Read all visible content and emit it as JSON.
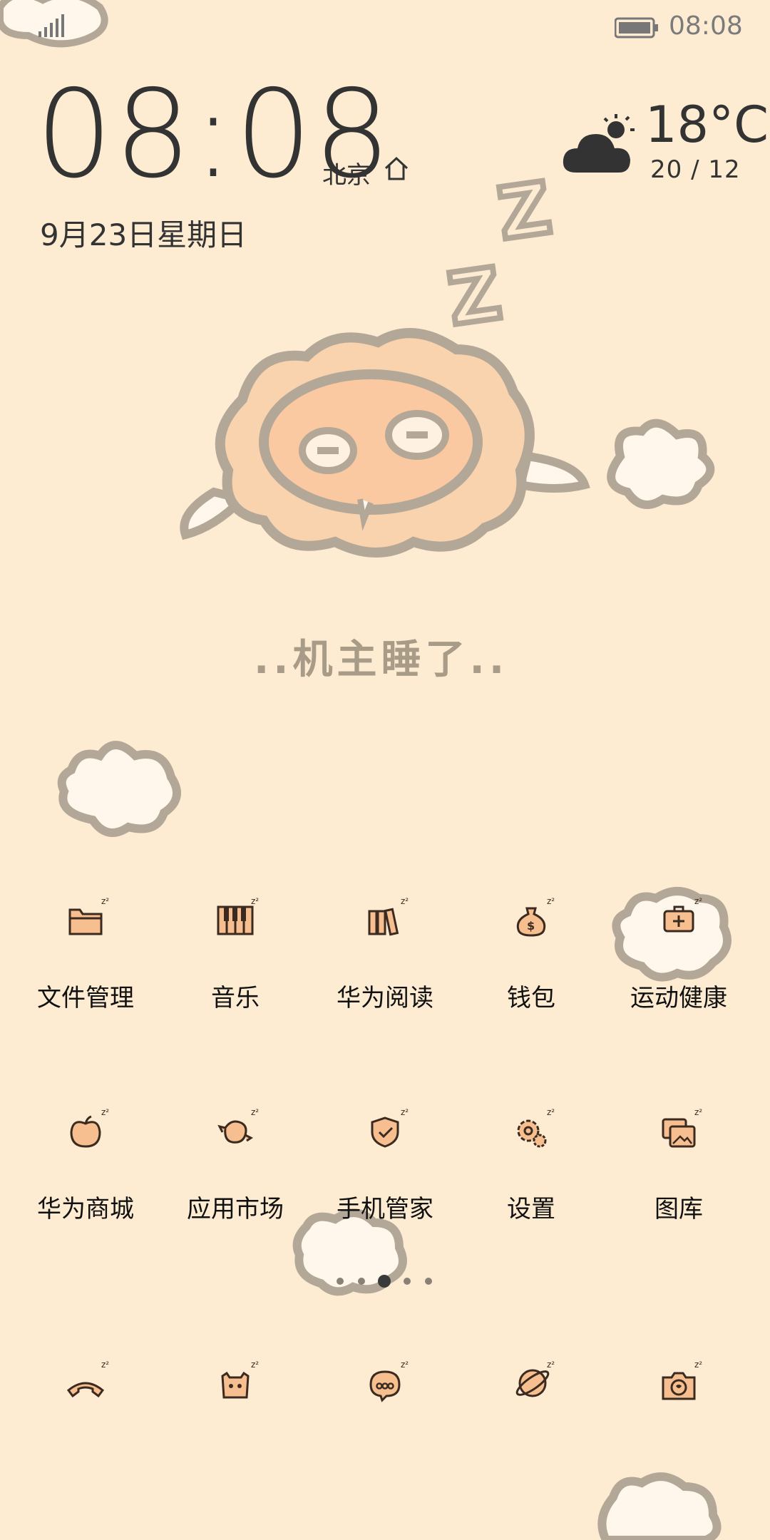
{
  "status_bar": {
    "time": "08:08"
  },
  "clock_widget": {
    "time": "08:08",
    "city": "北京",
    "date": "9月23日星期日",
    "temperature": "18°C",
    "temp_range": "20 / 12",
    "weather_icon": "partly-cloudy-icon"
  },
  "wallpaper": {
    "sleep_text": "..机主睡了.."
  },
  "apps_row1": [
    {
      "label": "文件管理",
      "icon": "folder-icon"
    },
    {
      "label": "音乐",
      "icon": "music-icon"
    },
    {
      "label": "华为阅读",
      "icon": "books-icon"
    },
    {
      "label": "钱包",
      "icon": "wallet-icon"
    },
    {
      "label": "运动健康",
      "icon": "health-icon"
    }
  ],
  "apps_row2": [
    {
      "label": "华为商城",
      "icon": "store-icon"
    },
    {
      "label": "应用市场",
      "icon": "app-market-icon"
    },
    {
      "label": "手机管家",
      "icon": "phone-manager-icon"
    },
    {
      "label": "设置",
      "icon": "settings-icon"
    },
    {
      "label": "图库",
      "icon": "gallery-icon"
    }
  ],
  "dock": [
    {
      "icon": "phone-icon"
    },
    {
      "icon": "contacts-icon"
    },
    {
      "icon": "messages-icon"
    },
    {
      "icon": "browser-icon"
    },
    {
      "icon": "camera-icon"
    }
  ],
  "page_indicator": {
    "count": 5,
    "active_index": 2
  },
  "colors": {
    "background": "#FDECD2",
    "icon_fill": "#F7BE8F",
    "icon_stroke": "#3b2a1f",
    "cloud_fill": "#FFF6EC",
    "cloud_stroke": "#B3A797"
  }
}
